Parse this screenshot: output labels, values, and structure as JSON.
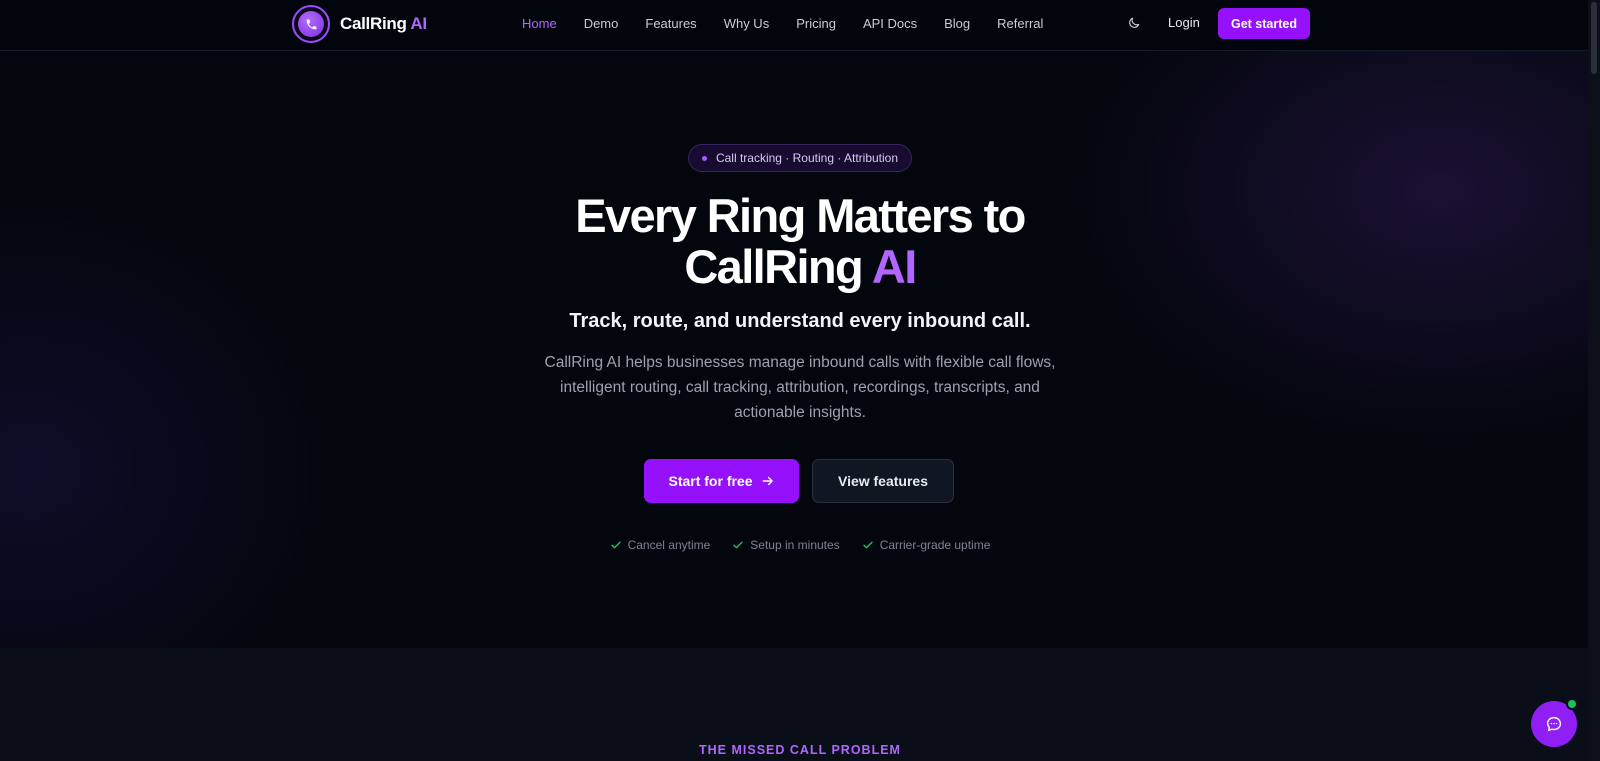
{
  "brand": {
    "name": "CallRing",
    "accent": "AI"
  },
  "nav": {
    "links": [
      {
        "label": "Home",
        "active": true
      },
      {
        "label": "Demo"
      },
      {
        "label": "Features"
      },
      {
        "label": "Why Us"
      },
      {
        "label": "Pricing"
      },
      {
        "label": "API Docs"
      },
      {
        "label": "Blog"
      },
      {
        "label": "Referral"
      }
    ],
    "login": "Login",
    "cta": "Get started"
  },
  "hero": {
    "badge": "Call tracking · Routing · Attribution",
    "headline_line1": "Every Ring Matters to",
    "headline_line2": "CallRing",
    "headline_accent": "AI",
    "subheadline": "Track, route, and understand every inbound call.",
    "description": "CallRing AI helps businesses manage inbound calls with flexible call flows, intelligent routing, call tracking, attribution, recordings, transcripts, and actionable insights.",
    "primary_cta": "Start for free",
    "secondary_cta": "View features",
    "checks": [
      "Cancel anytime",
      "Setup in minutes",
      "Carrier-grade uptime"
    ]
  },
  "next_section": {
    "label": "THE MISSED CALL PROBLEM"
  },
  "colors": {
    "accent": "#9511fb",
    "accent_text": "#b366ff",
    "background": "#04060e",
    "check": "#22c55e",
    "online": "#19c25a"
  },
  "icons": [
    "phone-icon",
    "moon-icon",
    "arrow-right-icon",
    "check-icon",
    "chat-icon"
  ]
}
